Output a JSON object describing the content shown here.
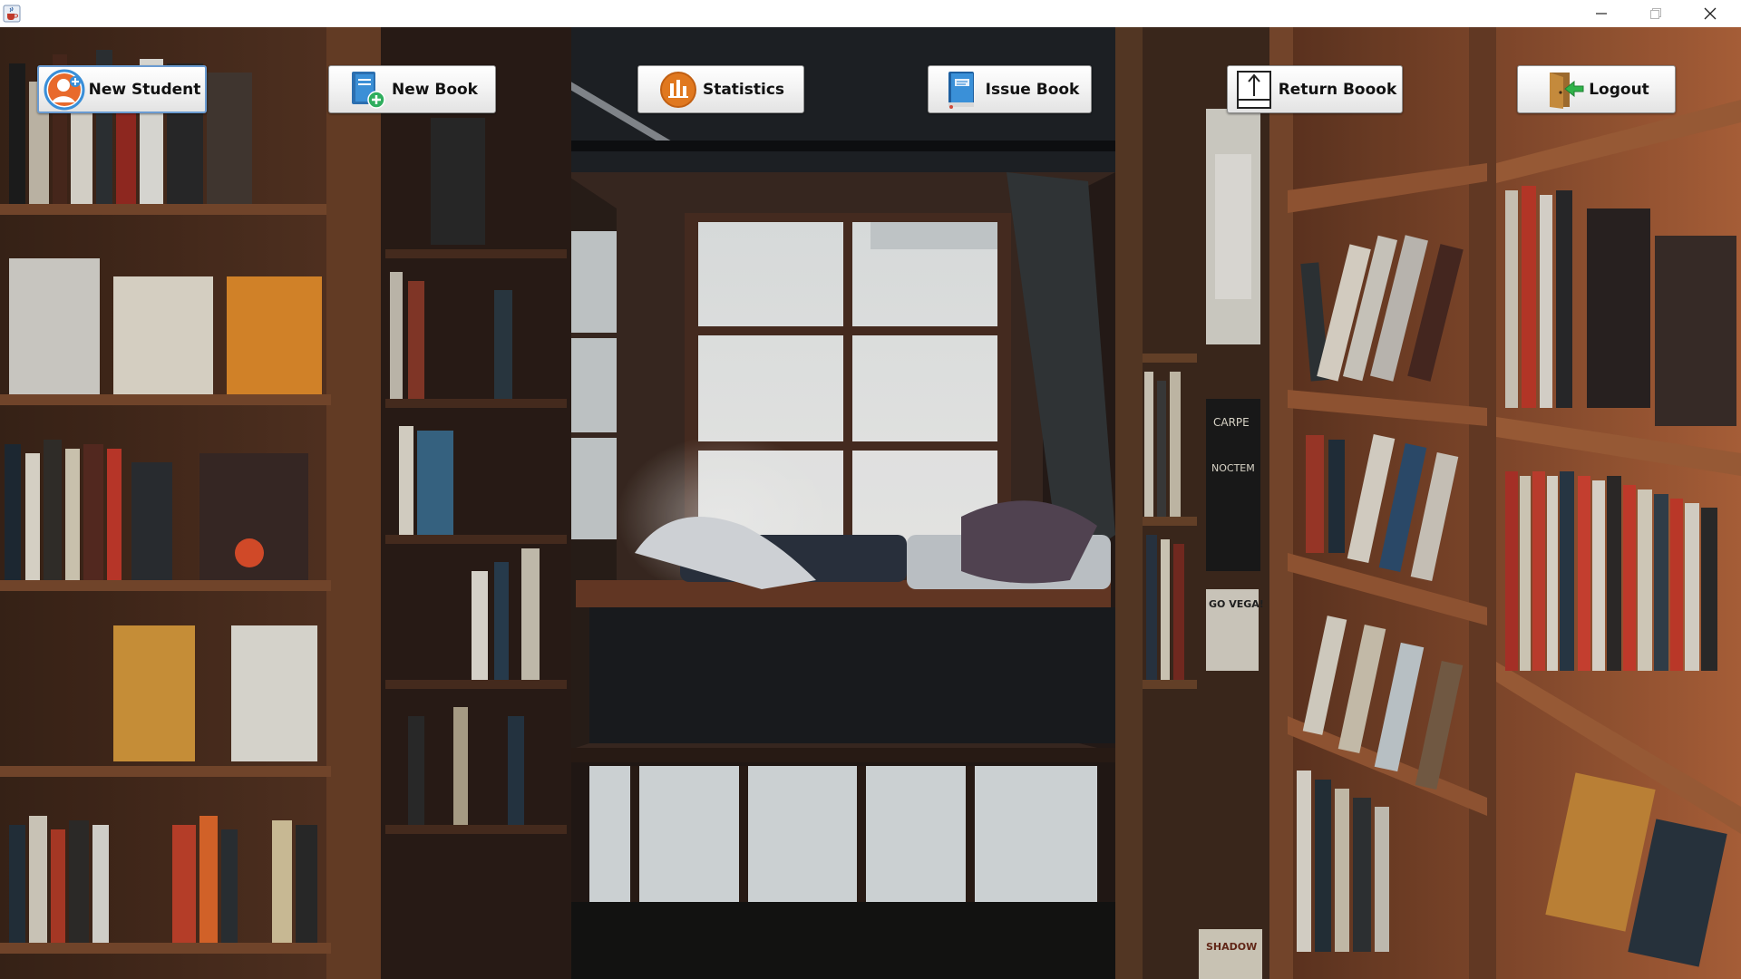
{
  "window": {
    "app_icon": "java-cup-icon",
    "controls": [
      "minimize-icon",
      "maximize-icon",
      "close-icon"
    ]
  },
  "toolbar": {
    "buttons": [
      {
        "label": "New Student",
        "icon": "add-user-icon"
      },
      {
        "label": "New Book",
        "icon": "add-book-icon"
      },
      {
        "label": "Statistics",
        "icon": "bar-chart-icon"
      },
      {
        "label": "Issue Book",
        "icon": "book-icon"
      },
      {
        "label": "Return Boook",
        "icon": "return-upload-icon"
      },
      {
        "label": "Logout",
        "icon": "logout-door-icon"
      }
    ]
  },
  "background": {
    "description_icon": "bookstore-reading-nook-photo",
    "poster_texts": [
      "CARPE",
      "NOCTEM",
      "GO VEGA!",
      "SHADOW"
    ]
  },
  "colors": {
    "button_focus_border": "#6a9bd1",
    "button_face": "#f4f4f4",
    "titlebar": "#ffffff"
  }
}
